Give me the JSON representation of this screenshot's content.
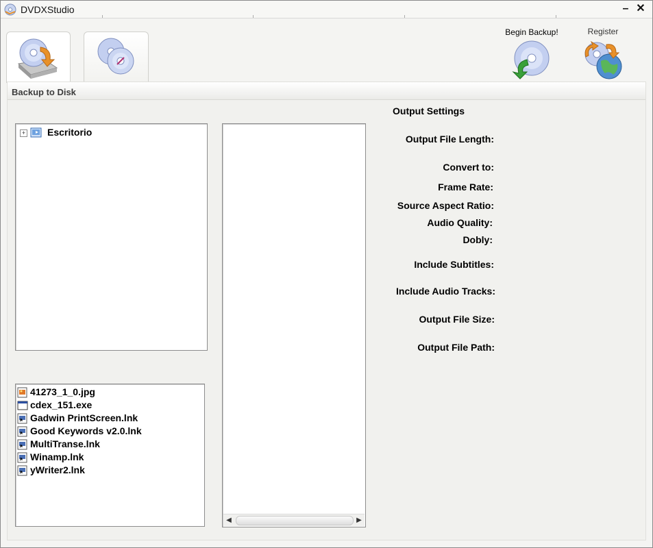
{
  "app": {
    "title": "DVDXStudio",
    "icon": "dvd-disc-icon",
    "window_controls": {
      "minimize": "–",
      "close": "✕"
    }
  },
  "tabs": [
    {
      "icon": "backup-to-disk-icon",
      "active": true
    },
    {
      "icon": "disc-to-disc-icon",
      "active": false
    }
  ],
  "actions": {
    "begin_backup": {
      "label": "Begin Backup!",
      "icon": "disc-arrow-icon"
    },
    "register": {
      "label": "Register",
      "icon": "register-globe-icon"
    }
  },
  "panel": {
    "title": "Backup to Disk"
  },
  "tree": {
    "root": {
      "label": "Escritorio",
      "icon": "desktop-folder-icon",
      "expander": "+"
    }
  },
  "files": [
    {
      "name": "41273_1_0.jpg",
      "icon": "image-file-icon"
    },
    {
      "name": "cdex_151.exe",
      "icon": "exe-file-icon"
    },
    {
      "name": "Gadwin PrintScreen.lnk",
      "icon": "shortcut-file-icon"
    },
    {
      "name": "Good Keywords v2.0.lnk",
      "icon": "shortcut-file-icon"
    },
    {
      "name": "MultiTranse.lnk",
      "icon": "shortcut-file-icon"
    },
    {
      "name": "Winamp.lnk",
      "icon": "shortcut-file-icon"
    },
    {
      "name": "yWriter2.lnk",
      "icon": "shortcut-file-icon"
    }
  ],
  "scrollbar": {
    "left": "◀",
    "right": "▶"
  },
  "output_settings": {
    "heading": "Output Settings",
    "labels": [
      "Output File Length:",
      "Convert to:",
      "Frame Rate:",
      "Source Aspect Ratio:",
      "Audio Quality:",
      "Dobly:",
      "Include Subtitles:",
      "Include Audio Tracks:",
      "Output File Size:",
      "Output File Path:"
    ]
  },
  "colors": {
    "accent_orange": "#e8912a",
    "disc_blue": "#9fb6e6",
    "arrow_green": "#3aa03a"
  }
}
